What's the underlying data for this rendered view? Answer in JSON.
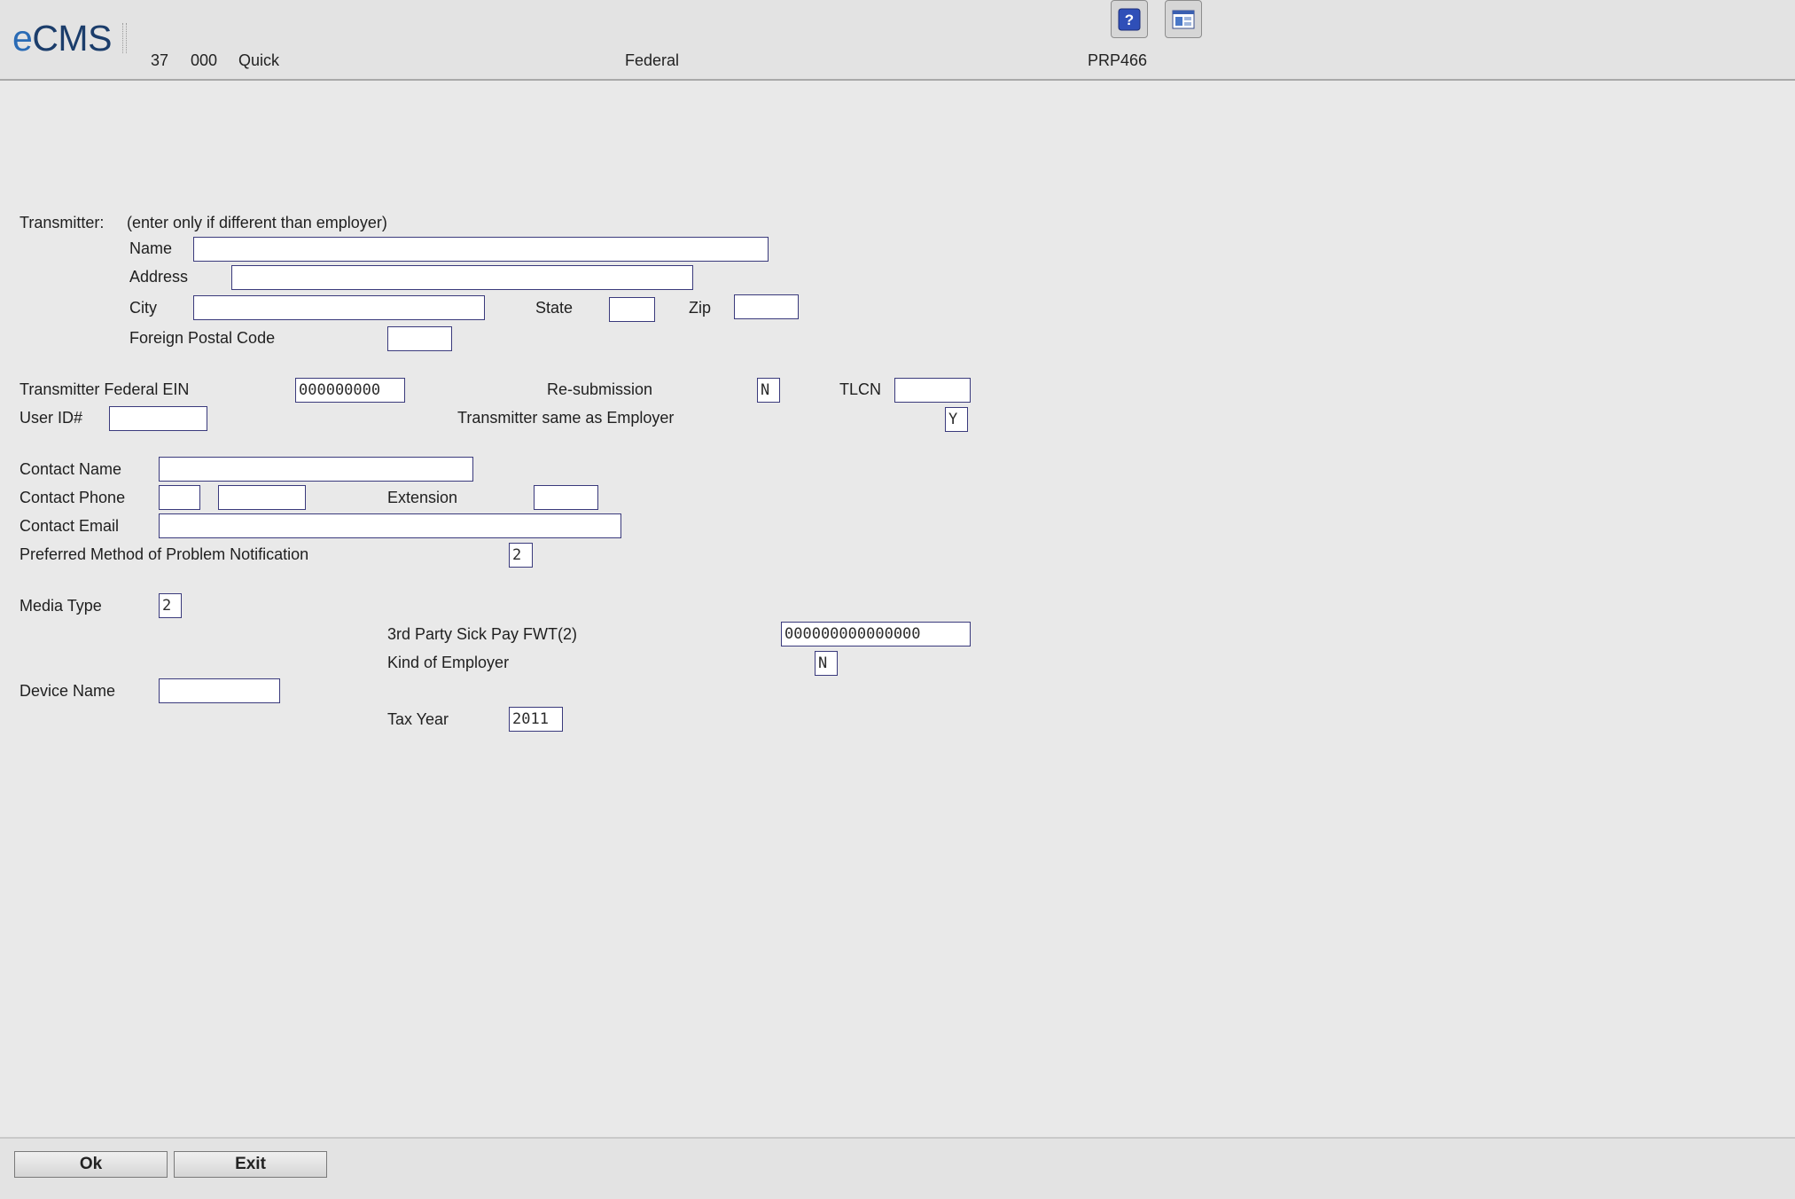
{
  "header": {
    "logo": "eCMS",
    "company": "37",
    "division": "000",
    "company_name": "Quick",
    "screen_title": "Federal",
    "program_id": "PRP466",
    "help_icon": "help-question-icon",
    "window_icon": "window-layout-icon"
  },
  "transmitter": {
    "heading": "Transmitter:",
    "note": "(enter only if different than employer)",
    "name_label": "Name",
    "name_value": "",
    "address_label": "Address",
    "address_value": "",
    "city_label": "City",
    "city_value": "",
    "state_label": "State",
    "state_value": "",
    "zip_label": "Zip",
    "zip_value": "",
    "foreign_postal_label": "Foreign Postal Code",
    "foreign_postal_value": ""
  },
  "ids": {
    "federal_ein_label": "Transmitter Federal EIN",
    "federal_ein_value": "000000000",
    "resubmission_label": "Re-submission",
    "resubmission_value": "N",
    "tlcn_label": "TLCN",
    "tlcn_value": "",
    "user_id_label": "User ID#",
    "user_id_value": "",
    "same_as_employer_label": "Transmitter same as Employer",
    "same_as_employer_value": "Y"
  },
  "contact": {
    "name_label": "Contact Name",
    "name_value": "",
    "phone_label": "Contact Phone",
    "phone_area_value": "",
    "phone_number_value": "",
    "extension_label": "Extension",
    "extension_value": "",
    "email_label": "Contact Email",
    "email_value": "",
    "notification_label": "Preferred Method of Problem Notification",
    "notification_value": "2"
  },
  "media": {
    "media_type_label": "Media Type",
    "media_type_value": "2",
    "sick_pay_label": "3rd Party Sick Pay FWT(2)",
    "sick_pay_value": "000000000000000",
    "kind_of_employer_label": "Kind of Employer",
    "kind_of_employer_value": "N",
    "device_name_label": "Device Name",
    "device_name_value": "",
    "tax_year_label": "Tax Year",
    "tax_year_value": "2011"
  },
  "footer": {
    "ok_label": "Ok",
    "exit_label": "Exit"
  }
}
